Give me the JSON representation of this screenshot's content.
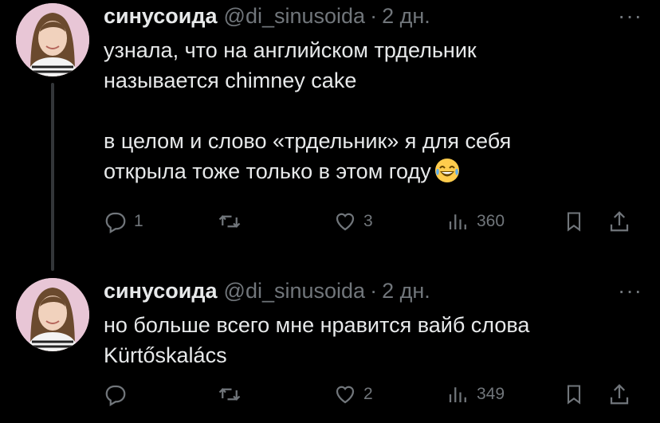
{
  "tweets": [
    {
      "name": "синусоида",
      "handle": "@di_sinusoida",
      "separator": "·",
      "time": "2 дн.",
      "more": "···",
      "lines": [
        "узнала, что на английском трдельник",
        "называется chimney cake",
        "в целом и слово «трдельник» я для себя",
        "открыла тоже только в этом году"
      ],
      "emoji": "laughing-face-icon",
      "replies": "1",
      "retweets": "",
      "likes": "3",
      "views": "360"
    },
    {
      "name": "синусоида",
      "handle": "@di_sinusoida",
      "separator": "·",
      "time": "2 дн.",
      "more": "···",
      "lines": [
        "но больше всего мне нравится вайб слова",
        "Kürtőskalács"
      ],
      "replies": "",
      "retweets": "",
      "likes": "2",
      "views": "349"
    }
  ],
  "colors": {
    "background": "#000000",
    "text": "#e7e9ea",
    "muted": "#71767b",
    "thread": "#333639"
  }
}
